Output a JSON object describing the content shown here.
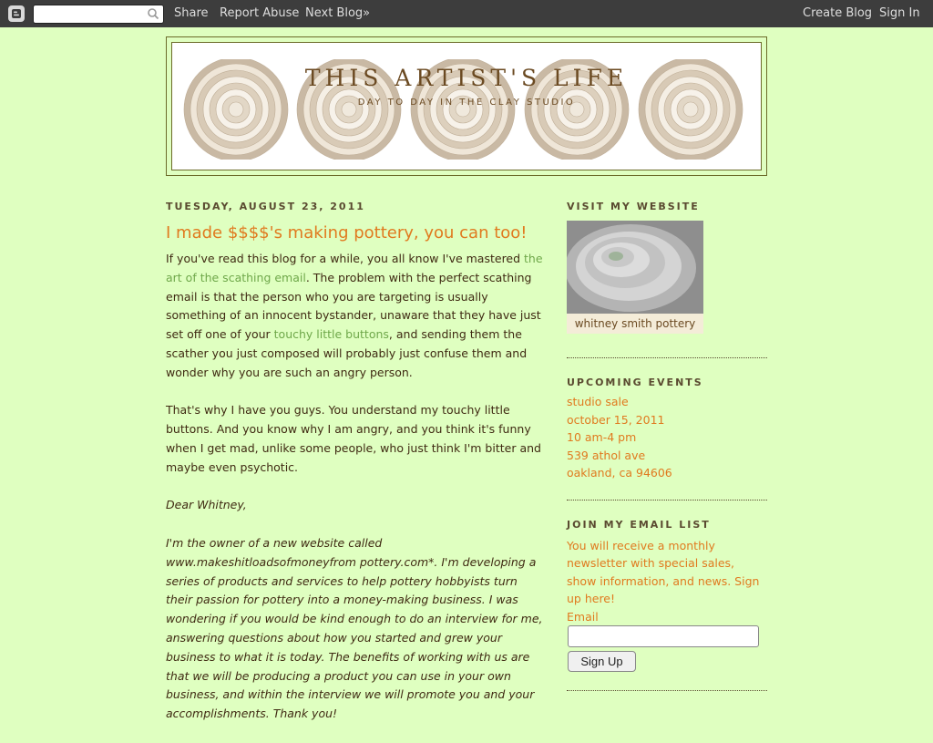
{
  "navbar": {
    "share": "Share",
    "report_abuse": "Report Abuse",
    "next_blog": "Next Blog»",
    "create_blog": "Create Blog",
    "sign_in": "Sign In",
    "search_placeholder": ""
  },
  "header": {
    "title": "THIS ARTIST'S LIFE",
    "description": "DAY TO DAY IN THE CLAY STUDIO"
  },
  "post": {
    "date": "TUESDAY, AUGUST 23, 2011",
    "title": "I made $$$$'s making pottery, you can too!",
    "p1_a": "If you've read this blog for a while, you all know I've mastered ",
    "p1_link1": "the art of the scathing email",
    "p1_b": ". The problem with the perfect scathing email is that the person who you are targeting is usually something of an innocent bystander, unaware that they have just set off one of your ",
    "p1_link2": "touchy little buttons",
    "p1_c": ", and sending them the scather you just composed will probably just confuse them and wonder why you are such an angry person.",
    "p2": "That's why I have you guys. You understand my touchy little buttons. And you know why I am angry, and you think it's funny when I get mad, unlike some people, who just think I'm bitter and maybe even psychotic.",
    "p3": "Dear Whitney,",
    "p4": "I'm the owner of a new website called www.makeshitloadsofmoneyfrom pottery.com*. I'm developing a series of products and services to help pottery hobbyists turn their passion for pottery into a money-making business. I was wondering if you would be kind enough to do an interview for me, answering questions about how you started and grew your business to what it is today. The benefits of working with us are that we will be producing a product you can use in your own business, and within the interview we will promote you and your accomplishments. Thank you!"
  },
  "sidebar": {
    "website_heading": "VISIT MY WEBSITE",
    "website_caption": "whitney smith pottery",
    "events_heading": "UPCOMING EVENTS",
    "events_lines": [
      "studio sale",
      "october 15, 2011",
      "10 am-4 pm",
      "539 athol ave",
      "oakland, ca 94606"
    ],
    "email_heading": "JOIN MY EMAIL LIST",
    "email_text": "You will receive a monthly newsletter with special sales, show information, and news. Sign up here!",
    "email_label": "Email",
    "signup_label": "Sign Up"
  },
  "colors": {
    "background": "#dfffc0",
    "accent_orange": "#e07a1f",
    "link_green": "#6fa84a",
    "navbar": "#3d3d3d"
  }
}
